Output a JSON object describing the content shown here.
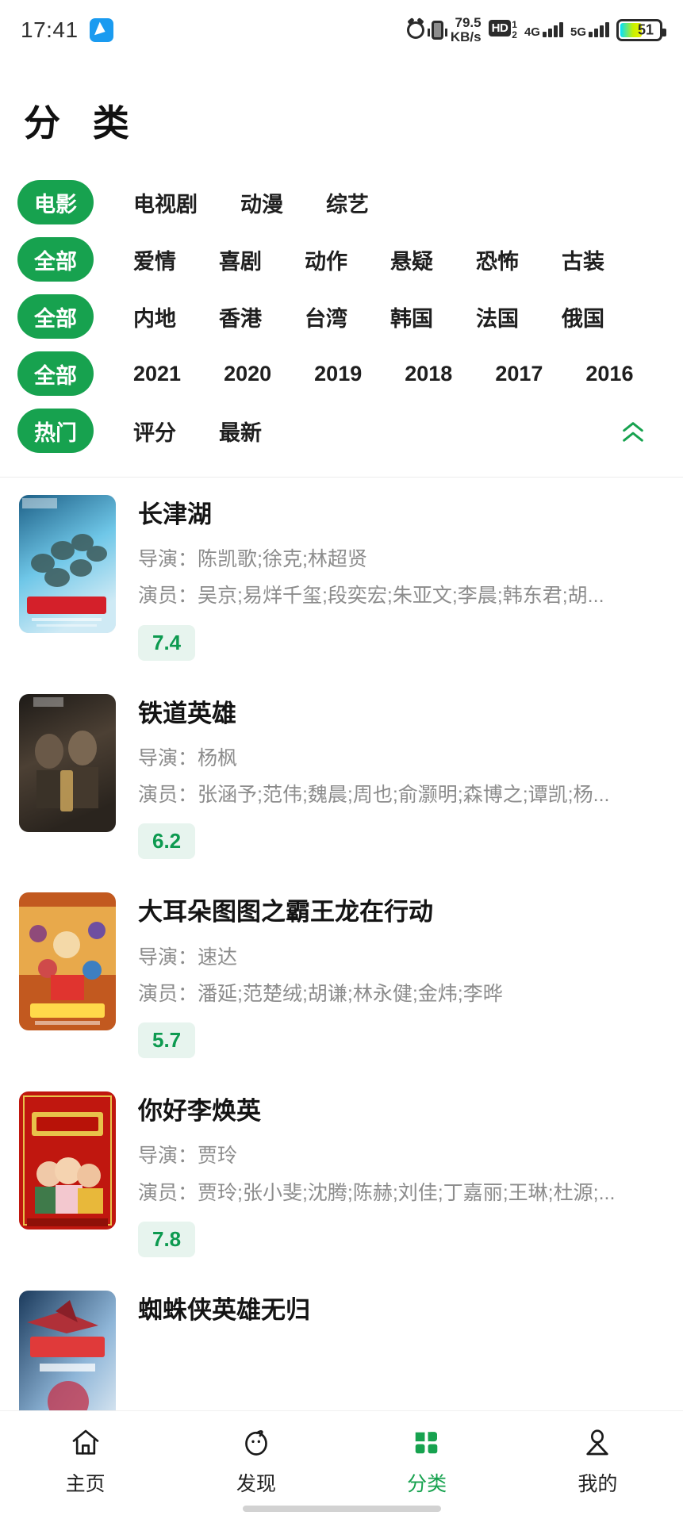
{
  "status_bar": {
    "time": "17:41",
    "app_icon": "messenger-icon",
    "alarm_icon": "alarm-icon",
    "vibrate_icon": "vibrate-icon",
    "net_speed": "79.5",
    "net_speed_unit": "KB/s",
    "hd_label": "HD",
    "hd_sub_top": "1",
    "hd_sub_bottom": "2",
    "sim1_net": "4G",
    "sim2_net": "5G",
    "battery_level": "51"
  },
  "header": {
    "title": "分 类"
  },
  "filters": {
    "rows": [
      {
        "name": "type",
        "selected": "电影",
        "options": [
          "电视剧",
          "动漫",
          "综艺"
        ]
      },
      {
        "name": "genre",
        "selected": "全部",
        "options": [
          "爱情",
          "喜剧",
          "动作",
          "悬疑",
          "恐怖",
          "古装"
        ]
      },
      {
        "name": "region",
        "selected": "全部",
        "options": [
          "内地",
          "香港",
          "台湾",
          "韩国",
          "法国",
          "俄国"
        ]
      },
      {
        "name": "year",
        "selected": "全部",
        "options": [
          "2021",
          "2020",
          "2019",
          "2018",
          "2017",
          "2016"
        ]
      },
      {
        "name": "sort",
        "selected": "热门",
        "options": [
          "评分",
          "最新"
        ]
      }
    ],
    "collapse_icon": "double-chevron-up-icon"
  },
  "labels": {
    "director_prefix": "导演：",
    "actor_prefix": "演员："
  },
  "movies": [
    {
      "title": "长津湖",
      "director": "导演：陈凯歌;徐克;林超贤",
      "actors": "演员：吴京;易烊千玺;段奕宏;朱亚文;李晨;韩东君;胡...",
      "rating": "7.4",
      "poster_colors": [
        "#1d5f86",
        "#6fc7e8",
        "#cfeaf5"
      ],
      "poster_title_color": "#d4202a"
    },
    {
      "title": "铁道英雄",
      "director": "导演：杨枫",
      "actors": "演员：张涵予;范伟;魏晨;周也;俞灏明;森博之;谭凯;杨...",
      "rating": "6.2",
      "poster_colors": [
        "#1d1a17",
        "#4c4034",
        "#2a241e"
      ],
      "poster_title_color": "#c9a35a"
    },
    {
      "title": "大耳朵图图之霸王龙在行动",
      "director": "导演：速达",
      "actors": "演员：潘延;范楚绒;胡谦;林永健;金炜;李晔",
      "rating": "5.7",
      "poster_colors": [
        "#c2591f",
        "#f0b840",
        "#8b2e8f"
      ],
      "poster_title_color": "#ffd94a"
    },
    {
      "title": "你好李焕英",
      "director": "导演：贾玲",
      "actors": "演员：贾玲;张小斐;沈腾;陈赫;刘佳;丁嘉丽;王琳;杜源;...",
      "rating": "7.8",
      "poster_colors": [
        "#c0170f",
        "#e8c24a",
        "#8f1008"
      ],
      "poster_title_color": "#ffe07a"
    },
    {
      "title": "蜘蛛侠英雄无归",
      "director": "",
      "actors": "",
      "rating": "",
      "poster_colors": [
        "#1b3a5c",
        "#8fb6d8",
        "#b03038"
      ],
      "poster_title_color": "#e03a3a"
    }
  ],
  "bottom_nav": {
    "items": [
      {
        "label": "主页",
        "icon": "home-icon",
        "active": false
      },
      {
        "label": "发现",
        "icon": "compass-icon",
        "active": false
      },
      {
        "label": "分类",
        "icon": "grid-icon",
        "active": true
      },
      {
        "label": "我的",
        "icon": "person-icon",
        "active": false
      }
    ]
  },
  "colors": {
    "accent_green": "#17a24f",
    "rating_text": "#0d9a50",
    "rating_bg": "#e7f4ee",
    "meta_gray": "#8c8c8c"
  }
}
